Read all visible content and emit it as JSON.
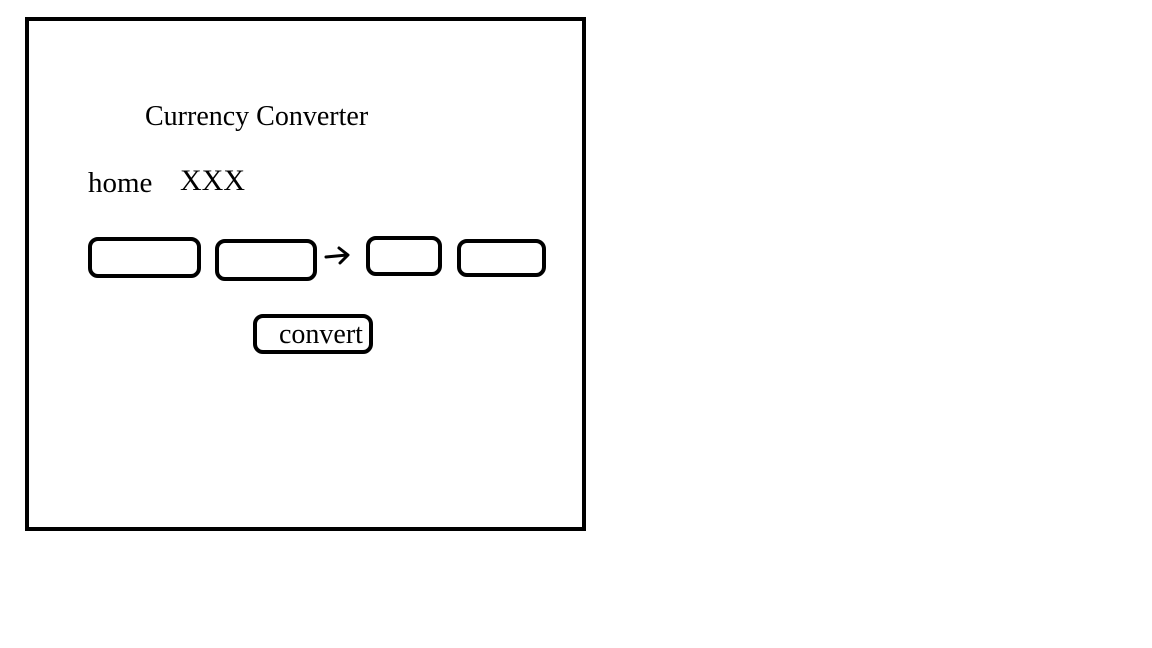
{
  "page": {
    "title": "Currency Converter"
  },
  "nav": {
    "home_label": "home",
    "second_label": "XXX"
  },
  "converter": {
    "amount_from_value": "",
    "currency_from_value": "",
    "arrow_icon": "arrow-right-icon",
    "amount_to_value": "",
    "currency_to_value": ""
  },
  "actions": {
    "convert_label": "convert"
  }
}
